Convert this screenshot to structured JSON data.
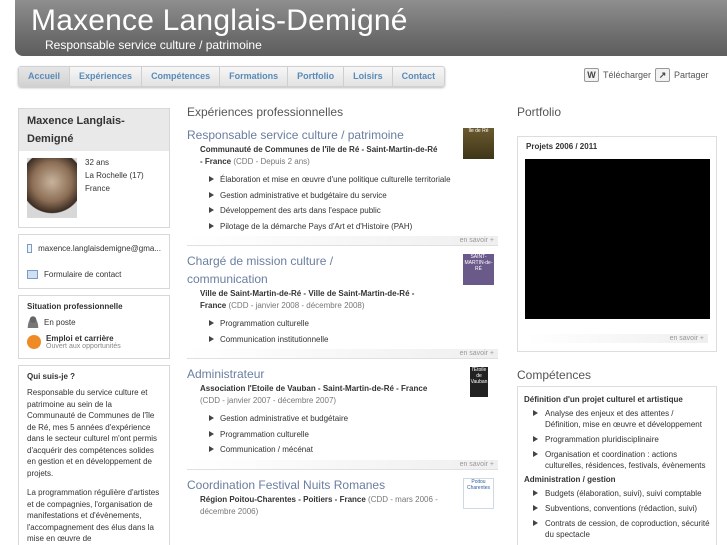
{
  "header": {
    "name": "Maxence Langlais-Demigné",
    "role": "Responsable service culture / patrimoine"
  },
  "nav": {
    "tabs": [
      "Accueil",
      "Expériences",
      "Compétences",
      "Formations",
      "Portfolio",
      "Loisirs",
      "Contact"
    ],
    "active": "Accueil"
  },
  "tools": {
    "download": "Télécharger",
    "share": "Partager",
    "download_icon_letter": "W"
  },
  "profile": {
    "name": "Maxence Langlais-Demigné",
    "age": "32 ans",
    "city": "La Rochelle (17)",
    "country": "France"
  },
  "contact": {
    "email": "maxence.langlaisdemigne@gma...",
    "form": "Formulaire de contact"
  },
  "situation": {
    "title": "Situation professionnelle",
    "status": "En poste",
    "job_label": "Emploi et carrière",
    "job_sub": "Ouvert aux opportunités"
  },
  "about": {
    "title": "Qui suis-je ?",
    "p1": "Responsable du service culture et patrimoine au sein de la Communauté de Communes de l'île de Ré, mes 5 années d'expérience dans le secteur culturel m'ont permis d'acquérir des compétences solides en gestion et en développement de projets.",
    "p2": "La programmation régulière d'artistes et de compagnies, l'organisation de manifestations et d'évènements, l'accompagnement des élus dans la mise en œuvre de"
  },
  "experiences": {
    "title": "Expériences professionnelles",
    "more": "en savoir +",
    "jobs": [
      {
        "title": "Responsable service culture / patrimoine",
        "org": "Communauté de Communes de l'île de Ré - Saint-Martin-de-Ré - France",
        "dates": "(CDD - Depuis 2 ans)",
        "items": [
          "Élaboration et mise en œuvre d'une politique culturelle territoriale",
          "Gestion administrative et budgétaire du service",
          "Développement des arts dans l'espace public",
          "Pilotage de la démarche Pays d'Art et d'Histoire (PAH)"
        ]
      },
      {
        "title": "Chargé de mission culture / communication",
        "org": "Ville de Saint-Martin-de-Ré - Ville de Saint-Martin-de-Ré - France",
        "dates": "(CDD - janvier 2008 - décembre 2008)",
        "items": [
          "Programmation culturelle",
          "Communication institutionnelle"
        ]
      },
      {
        "title": "Administrateur",
        "org": "Association l'Etoile de Vauban - Saint-Martin-de-Ré - France",
        "dates": "(CDD - janvier 2007 - décembre 2007)",
        "items": [
          "Gestion administrative et budgétaire",
          "Programmation culturelle",
          "Communication / mécénat"
        ]
      },
      {
        "title": "Coordination Festival Nuits Romanes",
        "org": "Région Poitou-Charentes - Poitiers - France",
        "dates": "(CDD - mars 2006 - décembre 2006)",
        "items": []
      }
    ],
    "logos": [
      "Île de Ré",
      "SAINT-MARTIN-de-RÉ",
      "l'Étoile de Vauban",
      "Poitou Charentes"
    ]
  },
  "portfolio": {
    "title": "Portfolio",
    "subtitle": "Projets 2006 / 2011",
    "more": "en savoir +"
  },
  "skills": {
    "title": "Compétences",
    "groups": [
      {
        "title": "Définition d'un projet culturel et artistique",
        "items": [
          "Analyse des enjeux et des attentes / Définition, mise en œuvre et développement",
          "Programmation pluridisciplinaire",
          "Organisation et coordination : actions culturelles, résidences, festivals, évènements"
        ]
      },
      {
        "title": "Administration / gestion",
        "items": [
          "Budgets (élaboration, suivi), suivi comptable",
          "Subventions, conventions (rédaction, suivi)",
          "Contrats de cession, de coproduction, sécurité du spectacle"
        ]
      }
    ]
  }
}
